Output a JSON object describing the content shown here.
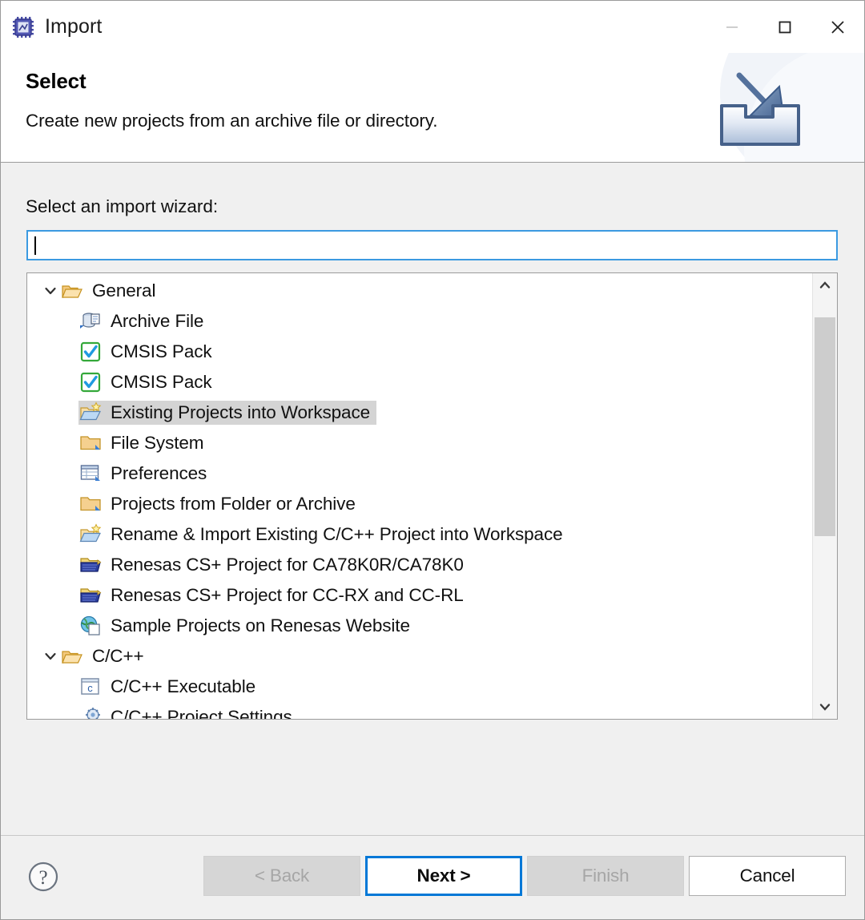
{
  "window": {
    "title": "Import",
    "icon": "chip-icon",
    "controls": {
      "minimize": "minimize-icon",
      "maximize": "maximize-icon",
      "close": "close-icon"
    }
  },
  "header": {
    "title": "Select",
    "description": "Create new projects from an archive file or directory.",
    "banner_icon": "import-tray-arrow-icon"
  },
  "form": {
    "label": "Select an import wizard:",
    "filter_value": "",
    "filter_placeholder": ""
  },
  "tree": {
    "rows": [
      {
        "label": "General",
        "icon": "open-folder-icon",
        "level": 0,
        "expanded": true,
        "selected": false
      },
      {
        "label": "Archive File",
        "icon": "archive-file-icon",
        "level": 1,
        "selected": false
      },
      {
        "label": "CMSIS Pack",
        "icon": "checkbox-checked-icon",
        "level": 1,
        "selected": false
      },
      {
        "label": "CMSIS Pack",
        "icon": "checkbox-checked-icon",
        "level": 1,
        "selected": false
      },
      {
        "label": "Existing Projects into Workspace",
        "icon": "import-project-folder-icon",
        "level": 1,
        "selected": true
      },
      {
        "label": "File System",
        "icon": "folder-icon",
        "level": 1,
        "selected": false
      },
      {
        "label": "Preferences",
        "icon": "preferences-table-icon",
        "level": 1,
        "selected": false
      },
      {
        "label": "Projects from Folder or Archive",
        "icon": "folder-icon",
        "level": 1,
        "selected": false
      },
      {
        "label": "Rename & Import Existing C/C++ Project into Workspace",
        "icon": "import-project-folder-icon",
        "level": 1,
        "selected": false
      },
      {
        "label": "Renesas CS+ Project for CA78K0R/CA78K0",
        "icon": "renesas-folder-icon",
        "level": 1,
        "selected": false
      },
      {
        "label": "Renesas CS+ Project for CC-RX and CC-RL",
        "icon": "renesas-folder-icon",
        "level": 1,
        "selected": false
      },
      {
        "label": "Sample Projects on Renesas Website",
        "icon": "globe-page-icon",
        "level": 1,
        "selected": false
      },
      {
        "label": "C/C++",
        "icon": "open-folder-icon",
        "level": 0,
        "expanded": true,
        "selected": false
      },
      {
        "label": "C/C++ Executable",
        "icon": "c-executable-icon",
        "level": 1,
        "selected": false
      },
      {
        "label": "C/C++ Project Settings",
        "icon": "project-settings-icon",
        "level": 1,
        "selected": false
      }
    ],
    "scrollbar": {
      "up_arrow": "chevron-up-icon",
      "down_arrow": "chevron-down-icon",
      "thumb_top_pct": 5,
      "thumb_height_pct": 55
    }
  },
  "footer": {
    "help_icon": "help-question-icon",
    "buttons": [
      {
        "label": "< Back",
        "state": "disabled"
      },
      {
        "label": "Next >",
        "state": "default"
      },
      {
        "label": "Finish",
        "state": "disabled"
      },
      {
        "label": "Cancel",
        "state": "normal"
      }
    ]
  },
  "colors": {
    "accent": "#0078d7",
    "focus_border": "#3b9ae1",
    "selection": "#d4d4d4",
    "dialog_bg": "#f0f0f0",
    "header_bg": "#ffffff"
  }
}
